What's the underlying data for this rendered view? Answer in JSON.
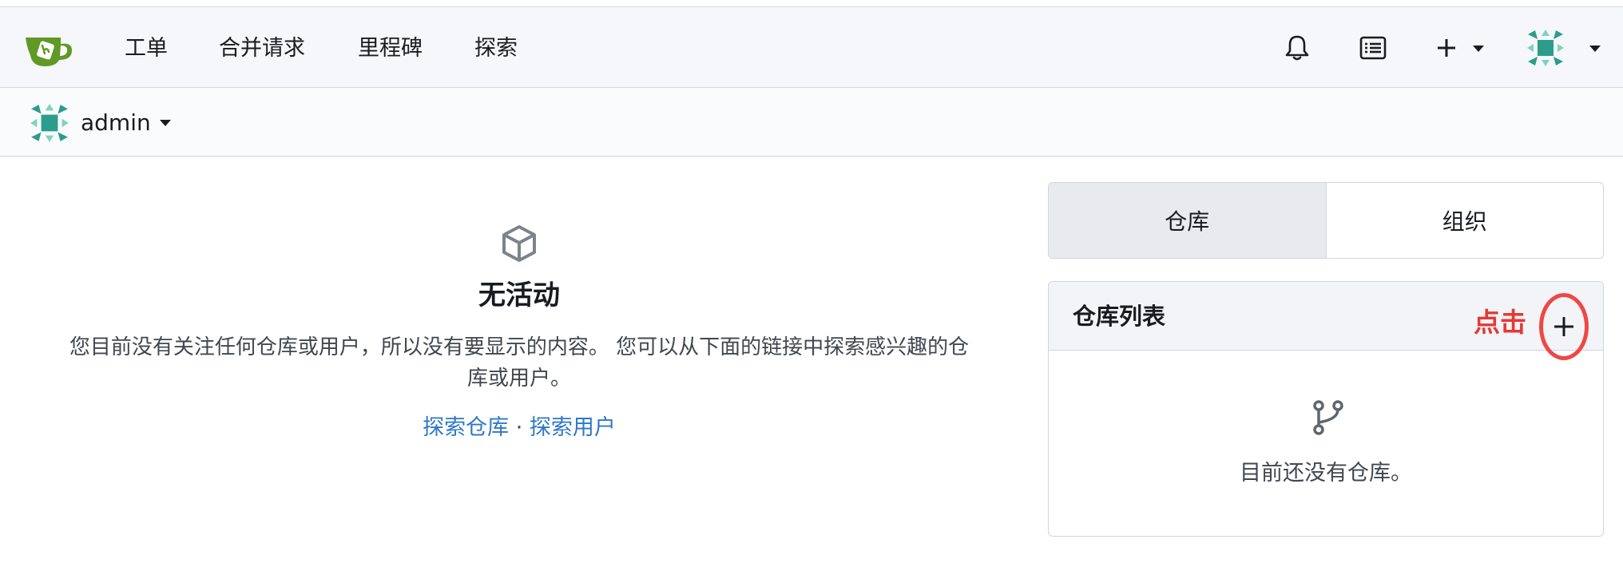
{
  "nav": {
    "logo_icon": "gitea-teacup-logo",
    "items": [
      {
        "label": "工单"
      },
      {
        "label": "合并请求"
      },
      {
        "label": "里程碑"
      },
      {
        "label": "探索"
      }
    ],
    "icons": [
      "bell-icon",
      "tasks-icon",
      "plus-icon",
      "avatar"
    ]
  },
  "context": {
    "username": "admin"
  },
  "feed": {
    "icon": "package-icon",
    "title": "无活动",
    "description": "您目前没有关注任何仓库或用户，所以没有要显示的内容。 您可以从下面的链接中探索感兴趣的仓库或用户。",
    "link_repos": "探索仓库",
    "separator": "·",
    "link_users": "探索用户"
  },
  "sidebar": {
    "tabs": [
      {
        "label": "仓库",
        "active": true
      },
      {
        "label": "组织",
        "active": false
      }
    ],
    "repo_list": {
      "title": "仓库列表",
      "annotation": "点击",
      "empty_icon": "repo-fork-icon",
      "empty_text": "目前还没有仓库。"
    }
  },
  "colors": {
    "link": "#2e78c7",
    "annotation": "#e53935",
    "logo_green": "#609926",
    "avatar_teal": "#2c9c8c"
  }
}
